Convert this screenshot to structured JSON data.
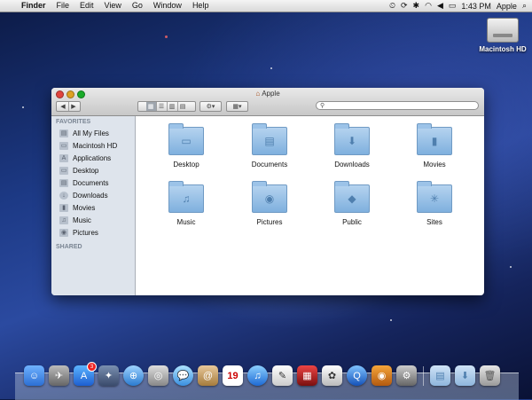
{
  "menubar": {
    "app_name": "Finder",
    "menus": [
      "File",
      "Edit",
      "View",
      "Go",
      "Window",
      "Help"
    ],
    "time": "1:43 PM",
    "user": "Apple"
  },
  "desktop": {
    "disk_label": "Macintosh HD"
  },
  "window": {
    "title": "Apple",
    "search_placeholder": ""
  },
  "sidebar": {
    "favorites_header": "FAVORITES",
    "shared_header": "SHARED",
    "items": [
      {
        "label": "All My Files",
        "icon": "all-files-icon"
      },
      {
        "label": "Macintosh HD",
        "icon": "hard-drive-icon"
      },
      {
        "label": "Applications",
        "icon": "applications-icon"
      },
      {
        "label": "Desktop",
        "icon": "desktop-icon"
      },
      {
        "label": "Documents",
        "icon": "documents-icon"
      },
      {
        "label": "Downloads",
        "icon": "downloads-icon"
      },
      {
        "label": "Movies",
        "icon": "movies-icon"
      },
      {
        "label": "Music",
        "icon": "music-icon"
      },
      {
        "label": "Pictures",
        "icon": "pictures-icon"
      }
    ]
  },
  "folders": [
    {
      "label": "Desktop",
      "icon": "desktop-folder-icon"
    },
    {
      "label": "Documents",
      "icon": "documents-folder-icon"
    },
    {
      "label": "Downloads",
      "icon": "downloads-folder-icon"
    },
    {
      "label": "Movies",
      "icon": "movies-folder-icon"
    },
    {
      "label": "Music",
      "icon": "music-folder-icon"
    },
    {
      "label": "Pictures",
      "icon": "pictures-folder-icon"
    },
    {
      "label": "Public",
      "icon": "public-folder-icon"
    },
    {
      "label": "Sites",
      "icon": "sites-folder-icon"
    }
  ],
  "dock": {
    "app_store_badge": "3",
    "calendar_day": "19"
  },
  "colors": {
    "folder_blue": "#7fb0de",
    "sidebar_bg": "#dee4ec",
    "badge_red": "#e22222"
  }
}
